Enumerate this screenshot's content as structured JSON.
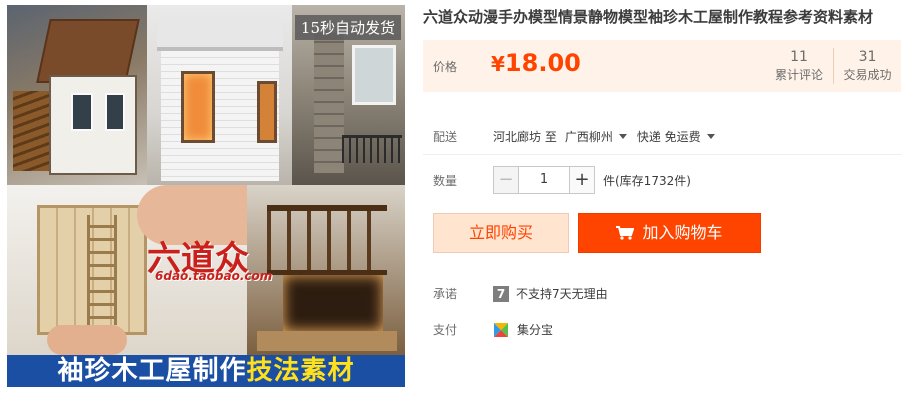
{
  "product": {
    "title": "六道众动漫手办模型情景静物模型袖珍木工屋制作教程参考资料素材"
  },
  "gallery": {
    "badge": "15秒自动发货",
    "watermark": "六道众",
    "watermark_url": "6dao.taobao.com",
    "banner_prefix": "袖珍木工屋制作",
    "banner_highlight": "技法素材"
  },
  "price": {
    "label": "价格",
    "currency": "¥",
    "value": "18.00",
    "reviews_count": "11",
    "reviews_label": "累计评论",
    "sales_count": "31",
    "sales_label": "交易成功"
  },
  "shipping": {
    "label": "配送",
    "origin": "河北廊坊 至",
    "destination": "广西柳州",
    "method": "快递 免运费"
  },
  "quantity": {
    "label": "数量",
    "minus": "−",
    "value": "1",
    "plus": "+",
    "stock": "件(库存1732件)"
  },
  "actions": {
    "buy_now": "立即购买",
    "add_to_cart": "加入购物车"
  },
  "promise": {
    "label": "承诺",
    "badge": "7",
    "text": "不支持7天无理由"
  },
  "payment": {
    "label": "支付",
    "method": "集分宝"
  },
  "colors": {
    "accent": "#ff4400",
    "price_bg": "#fff2e8",
    "buy_bg": "#ffe4d0"
  }
}
